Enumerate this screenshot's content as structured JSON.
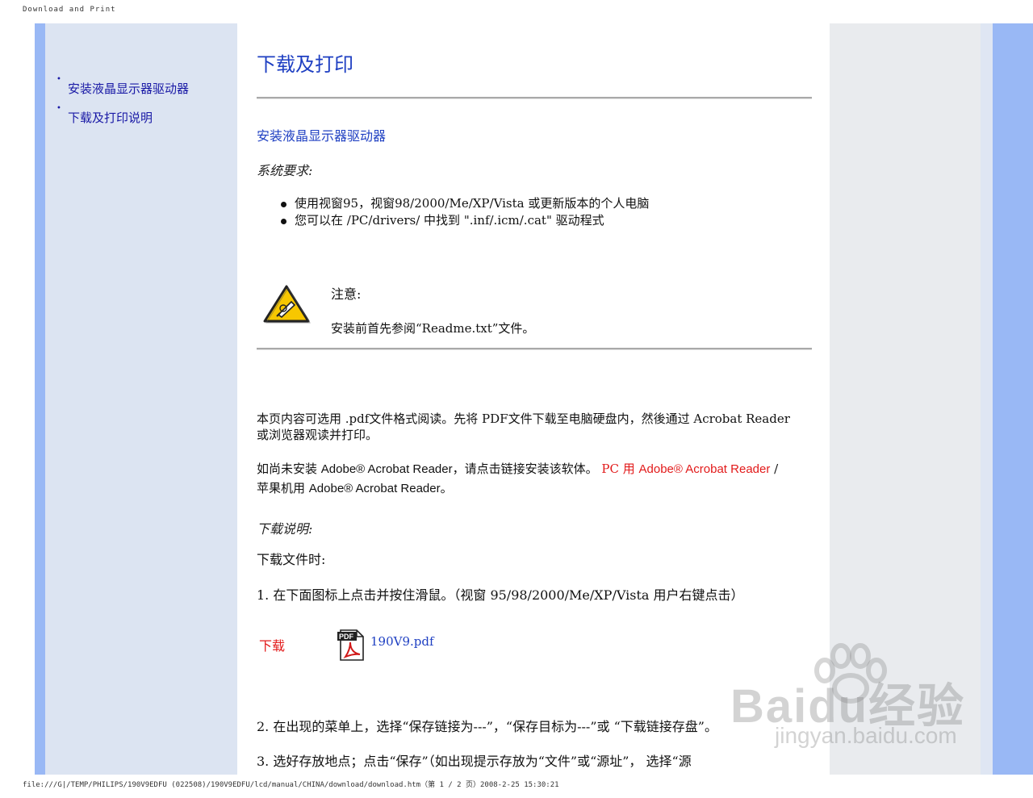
{
  "print_header": "Download and Print",
  "print_footer": "file:///G|/TEMP/PHILIPS/190V9EDFU (022508)/190V9EDFU/lcd/manual/CHINA/download/download.htm（第 1 / 2 页）2008-2-25 15:30:21",
  "sidebar": {
    "items": [
      {
        "bullet": "•",
        "label": "安装液晶显示器驱动器"
      },
      {
        "bullet": "•",
        "label": "下载及打印说明"
      }
    ]
  },
  "main": {
    "title": "下载及打印",
    "install_heading": "安装液晶显示器驱动器",
    "requirements_label": "系统要求:",
    "requirements": [
      "使用视窗95，视窗98/2000/Me/XP/Vista 或更新版本的个人电脑",
      "您可以在 /PC/drivers/ 中找到 \".inf/.icm/.cat\" 驱动程式"
    ],
    "note_label": "注意:",
    "note_text": "安装前首先参阅“Readme.txt”文件。",
    "pdf_para": "本页内容可选用 .pdf文件格式阅读。先将 PDF文件下载至电脑硬盘内，然後通过 Acrobat Reader或浏览器观读并打印。",
    "install_reader_prefix": "如尚未安装 ",
    "install_reader_product": "Adobe® Acrobat Reader",
    "install_reader_suffix": "，请点击链接安装该软体。",
    "pc_link_prefix": "PC 用 ",
    "pc_link_product": "Adobe® Acrobat Reader",
    "separator": " /",
    "mac_link_prefix": "苹果机用 ",
    "mac_link_product": "Adobe® Acrobat Reader",
    "mac_link_suffix": "。",
    "download_instructions_label": "下载说明:",
    "download_file_label": "下载文件时:",
    "step1": "1. 在下面图标上点击并按住滑鼠。（视窗 95/98/2000/Me/XP/Vista 用户右键点击）",
    "download_label": "下载",
    "pdf_file": "190V9.pdf",
    "step2": "2. 在出现的菜单上，选择“保存链接为---”，“保存目标为---”或 “下载链接存盘”。",
    "step3": "3. 选好存放地点；点击“保存”（如出现提示存放为“文件”或“源址”， 选择“源"
  },
  "watermark": {
    "brand": "Baidu经验",
    "url": "jingyan.baidu.com"
  },
  "colors": {
    "accent_blue": "#1e3fc2",
    "note_red": "#e21a1a",
    "stripe_blue": "#99b8f5",
    "sidebar_bg": "#dce4f2"
  },
  "icons": [
    "warning-triangle-icon",
    "pdf-file-icon",
    "paw-watermark-icon"
  ]
}
